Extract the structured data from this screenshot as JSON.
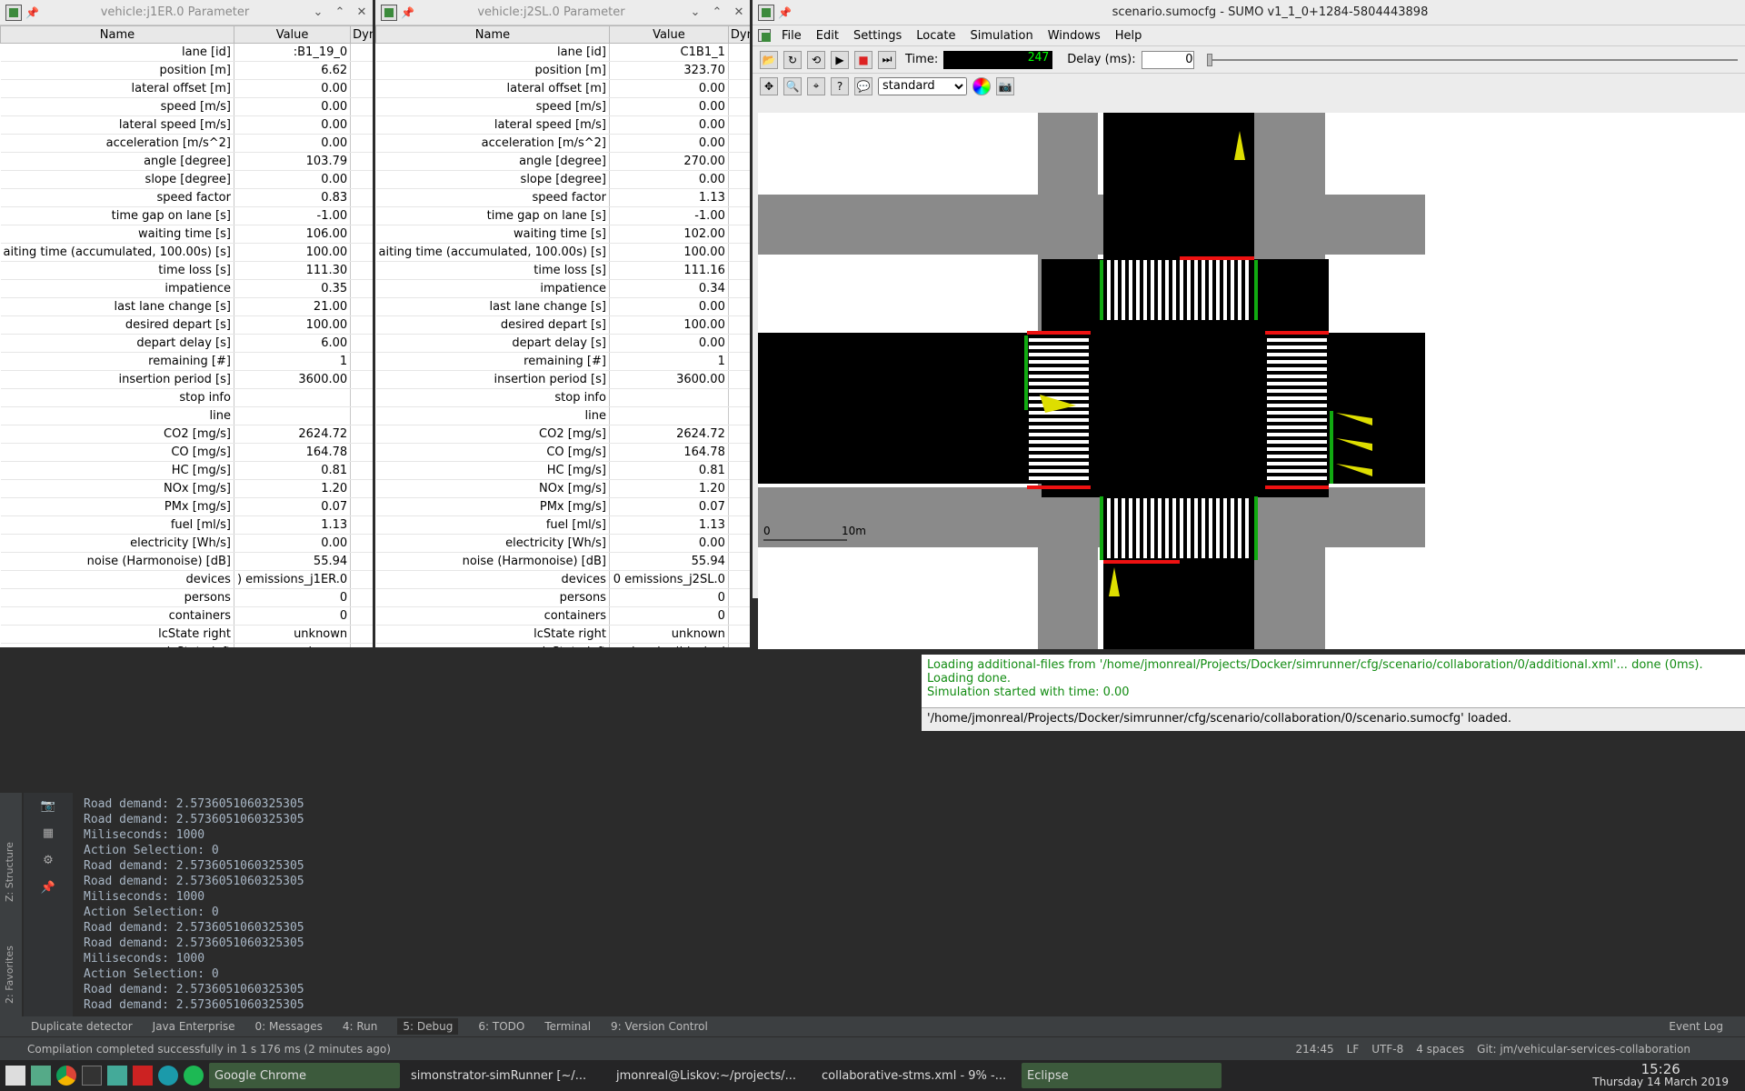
{
  "rows": [
    "lane [id]",
    "position [m]",
    "lateral offset [m]",
    "speed [m/s]",
    "lateral speed [m/s]",
    "acceleration [m/s^2]",
    "angle [degree]",
    "slope [degree]",
    "speed factor",
    "time gap on lane [s]",
    "waiting time [s]",
    "aiting time (accumulated, 100.00s) [s]",
    "time loss [s]",
    "impatience",
    "last lane change [s]",
    "desired depart [s]",
    "depart delay [s]",
    "remaining [#]",
    "insertion period [s]",
    "stop info",
    "line",
    "CO2 [mg/s]",
    "CO [mg/s]",
    "HC [mg/s]",
    "NOx [mg/s]",
    "PMx [mg/s]",
    "fuel [ml/s]",
    "electricity [Wh/s]",
    "noise (Harmonoise) [dB]",
    "devices",
    "persons",
    "containers",
    "lcState right",
    "lcState left"
  ],
  "panel1": {
    "title": "vehicle:j1ER.0 Parameter",
    "col_name": "Name",
    "col_value": "Value",
    "col_dynamic": "Dynamic",
    "values": [
      ":B1_19_0",
      "6.62",
      "0.00",
      "0.00",
      "0.00",
      "0.00",
      "103.79",
      "0.00",
      "0.83",
      "-1.00",
      "106.00",
      "100.00",
      "111.30",
      "0.35",
      "21.00",
      "100.00",
      "6.00",
      "1",
      "3600.00",
      "",
      "",
      "2624.72",
      "164.78",
      "0.81",
      "1.20",
      "0.07",
      "1.13",
      "0.00",
      "55.94",
      ") emissions_j1ER.0",
      "0",
      "0",
      "unknown",
      "unknown"
    ],
    "dynamic": [
      0,
      1,
      1,
      1,
      1,
      1,
      1,
      1,
      0,
      1,
      1,
      1,
      1,
      1,
      1,
      0,
      0,
      0,
      0,
      0,
      0,
      1,
      1,
      1,
      1,
      1,
      1,
      1,
      1,
      0,
      1,
      1,
      0,
      0
    ]
  },
  "panel2": {
    "title": "vehicle:j2SL.0 Parameter",
    "col_name": "Name",
    "col_value": "Value",
    "col_dynamic": "Dynamic",
    "values": [
      "C1B1_1",
      "323.70",
      "0.00",
      "0.00",
      "0.00",
      "0.00",
      "270.00",
      "0.00",
      "1.13",
      "-1.00",
      "102.00",
      "100.00",
      "111.16",
      "0.34",
      "0.00",
      "100.00",
      "0.00",
      "1",
      "3600.00",
      "",
      "",
      "2624.72",
      "164.78",
      "0.81",
      "1.20",
      "0.07",
      "1.13",
      "0.00",
      "55.94",
      "0 emissions_j2SL.0",
      "0",
      "0",
      "unknown",
      "verlapping|blocked"
    ],
    "dynamic": [
      0,
      1,
      1,
      1,
      1,
      1,
      1,
      1,
      0,
      1,
      1,
      1,
      1,
      1,
      1,
      0,
      0,
      0,
      0,
      0,
      0,
      1,
      1,
      1,
      1,
      1,
      1,
      1,
      1,
      0,
      1,
      1,
      0,
      0
    ]
  },
  "sumo": {
    "title": "scenario.sumocfg - SUMO v1_1_0+1284-5804443898",
    "menu": [
      "File",
      "Edit",
      "Settings",
      "Locate",
      "Simulation",
      "Windows",
      "Help"
    ],
    "time_label": "Time:",
    "delay_label": "Delay (ms):",
    "delay_value": "0",
    "scheme": "standard",
    "scale_0": "0",
    "scale_10": "10m",
    "log": [
      "Loading additional-files from '/home/jmonreal/Projects/Docker/simrunner/cfg/scenario/collaboration/0/additional.xml'... done (0ms).",
      "Loading done.",
      "Simulation started with time: 0.00"
    ],
    "status": "'/home/jmonreal/Projects/Docker/simrunner/cfg/scenario/collaboration/0/scenario.sumocfg' loaded."
  },
  "ide": {
    "console": [
      "Road demand: 2.5736051060325305",
      "Road demand: 2.5736051060325305",
      "Miliseconds: 1000",
      "Action Selection: 0",
      "Road demand: 2.5736051060325305",
      "Road demand: 2.5736051060325305",
      "Miliseconds: 1000",
      "Action Selection: 0",
      "Road demand: 2.5736051060325305",
      "Road demand: 2.5736051060325305",
      "Miliseconds: 1000",
      "Action Selection: 0",
      "Road demand: 2.5736051060325305",
      "Road demand: 2.5736051060325305"
    ],
    "side_structure": "Z: Structure",
    "side_favorites": "2: Favorites",
    "tabs": [
      "Duplicate detector",
      "Java Enterprise",
      "0: Messages",
      "4: Run",
      "5: Debug",
      "6: TODO",
      "Terminal",
      "9: Version Control"
    ],
    "event_log": "Event Log",
    "status_msg": "Compilation completed successfully in 1 s 176 ms (2 minutes ago)",
    "pos": "214:45",
    "lf": "LF",
    "enc": "UTF-8",
    "indent": "4 spaces",
    "git": "Git: jm/vehicular-services-collaboration"
  },
  "taskbar": {
    "tasks": [
      "Google Chrome",
      "simonstrator-simRunner [~/...",
      "jmonreal@Liskov:~/projects/...",
      "collaborative-stms.xml - 9% -...",
      "Eclipse"
    ],
    "time": "15:26",
    "date": "Thursday 14 March 2019"
  }
}
